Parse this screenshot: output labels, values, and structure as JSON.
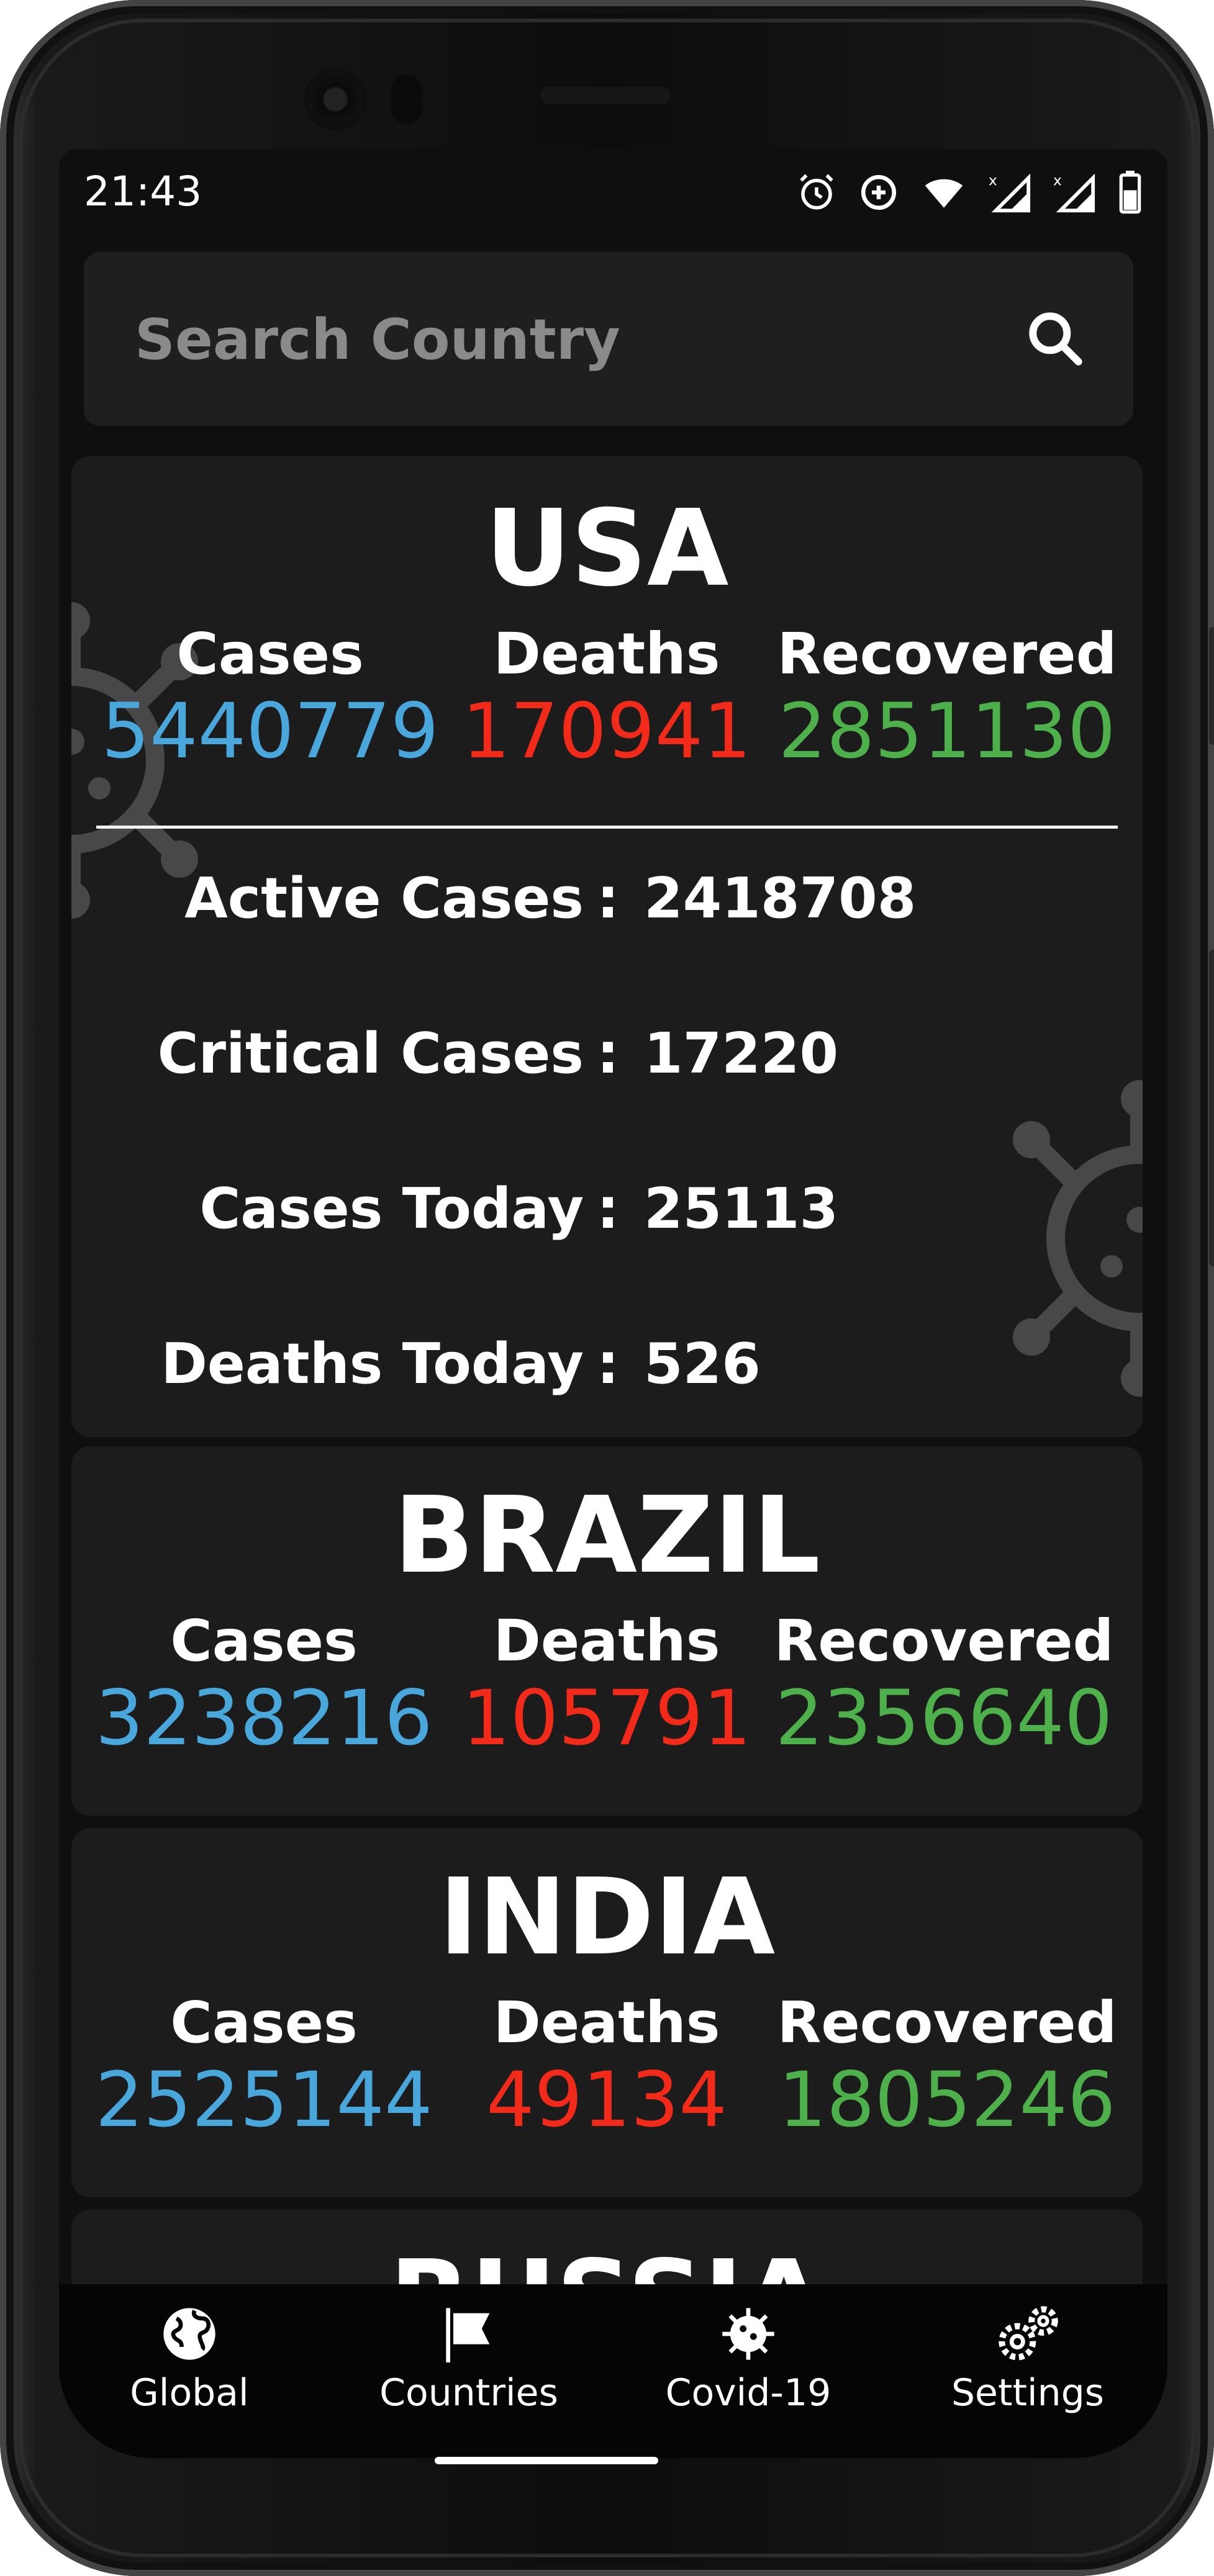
{
  "status_bar": {
    "time": "21:43"
  },
  "search": {
    "placeholder": "Search Country",
    "value": ""
  },
  "countries": [
    {
      "name": "USA",
      "cases_label": "Cases",
      "cases": "5440779",
      "deaths_label": "Deaths",
      "deaths": "170941",
      "recovered_label": "Recovered",
      "recovered": "2851130",
      "details": [
        {
          "label": "Active Cases",
          "value": "2418708"
        },
        {
          "label": "Critical Cases",
          "value": "17220"
        },
        {
          "label": "Cases Today",
          "value": "25113"
        },
        {
          "label": "Deaths Today",
          "value": "526"
        }
      ],
      "separator": ":"
    },
    {
      "name": "BRAZIL",
      "cases_label": "Cases",
      "cases": "3238216",
      "deaths_label": "Deaths",
      "deaths": "105791",
      "recovered_label": "Recovered",
      "recovered": "2356640"
    },
    {
      "name": "INDIA",
      "cases_label": "Cases",
      "cases": "2525144",
      "deaths_label": "Deaths",
      "deaths": "49134",
      "recovered_label": "Recovered",
      "recovered": "1805246"
    },
    {
      "name": "RUSSIA"
    }
  ],
  "colors": {
    "cases": "#4aa7dc",
    "deaths": "#f12a1a",
    "recovered": "#4db04a"
  },
  "bottom_nav": [
    {
      "label": "Global",
      "icon": "globe-icon"
    },
    {
      "label": "Countries",
      "icon": "flag-icon"
    },
    {
      "label": "Covid-19",
      "icon": "virus-icon"
    },
    {
      "label": "Settings",
      "icon": "gears-icon"
    }
  ]
}
